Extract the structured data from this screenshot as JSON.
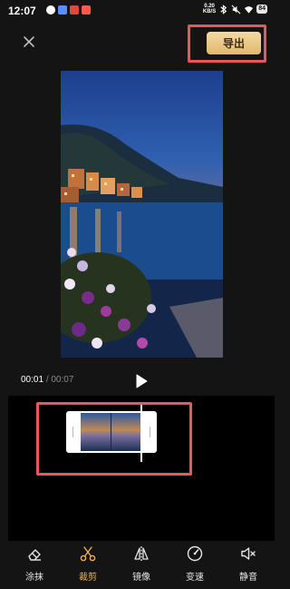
{
  "status_bar": {
    "time": "12:07",
    "net_speed_value": "0.20",
    "net_speed_unit": "KB/S",
    "battery": "84"
  },
  "header": {
    "close_icon": "close-icon",
    "export_label": "导出"
  },
  "playback": {
    "current_time": "00:01",
    "separator": "/",
    "total_time": "00:07",
    "play_icon": "play-icon"
  },
  "toolbar": {
    "items": [
      {
        "label": "涂抹",
        "icon": "eraser-icon",
        "active": false
      },
      {
        "label": "裁剪",
        "icon": "scissors-icon",
        "active": true
      },
      {
        "label": "镜像",
        "icon": "mirror-icon",
        "active": false
      },
      {
        "label": "变速",
        "icon": "speed-icon",
        "active": false
      },
      {
        "label": "静音",
        "icon": "mute-icon",
        "active": false
      }
    ]
  },
  "colors": {
    "background": "#141414",
    "timeline_background": "#000000",
    "accent": "#f0b24b",
    "export_button": "#e9c27e",
    "highlight_box": "#e9575c"
  }
}
